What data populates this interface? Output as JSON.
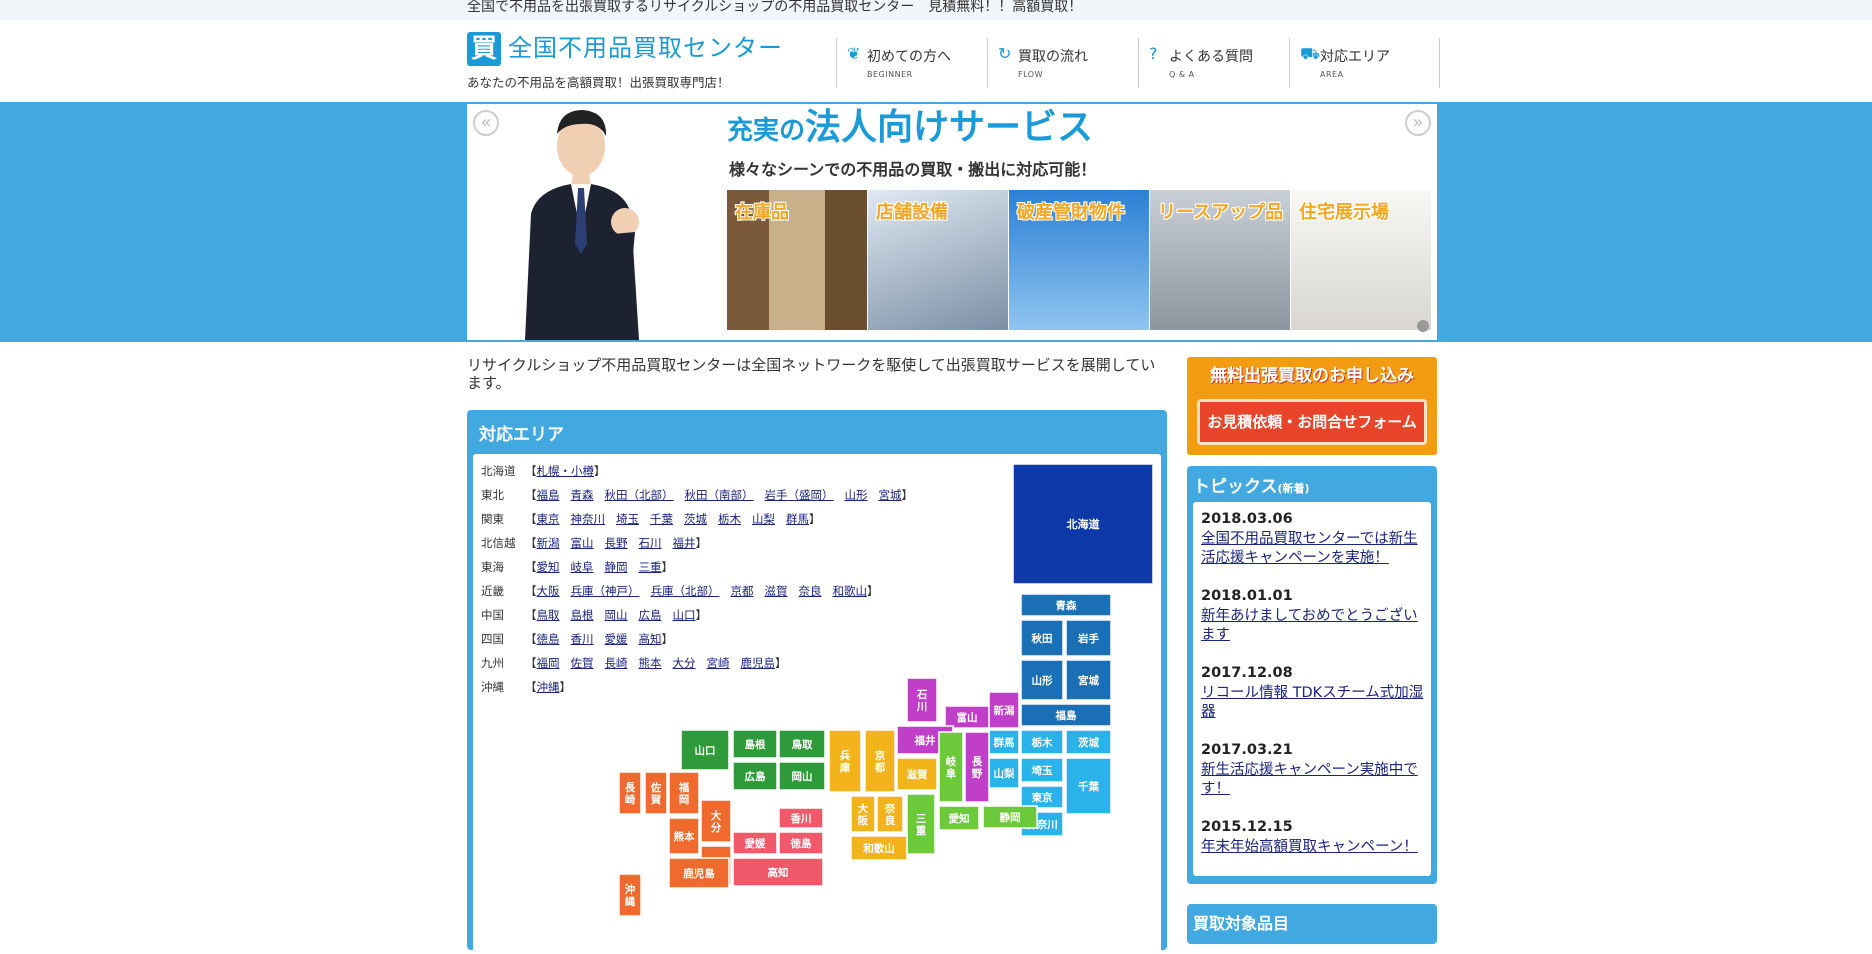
{
  "topbar": {
    "text": "全国で不用品を出張買取するリサイクルショップの不用品買取センター　見積無料！！高額買取！"
  },
  "header": {
    "logo_char": "買",
    "logo_title": "全国不用品買取センター",
    "logo_sub": "あなたの不用品を高額買取！出張買取専門店！",
    "nav": [
      {
        "label": "初めての方へ",
        "sub": "BEGINNER",
        "icon": "leaf-icon"
      },
      {
        "label": "買取の流れ",
        "sub": "FLOW",
        "icon": "refresh-icon"
      },
      {
        "label": "よくある質問",
        "sub": "Q & A",
        "icon": "question-icon"
      },
      {
        "label": "対応エリア",
        "sub": "AREA",
        "icon": "truck-icon"
      }
    ]
  },
  "hero": {
    "prev": "«",
    "next": "»",
    "title_small": "充実の",
    "title_main": "法人向けサービス",
    "lead": "様々なシーンでの不用品の買取・搬出に対応可能！",
    "tiles": [
      "在庫品",
      "店舗設備",
      "破産管財物件",
      "リースアップ品",
      "住宅展示場"
    ]
  },
  "intro": "リサイクルショップ不用品買取センターは全国ネットワークを駆使して出張買取サービスを展開しています。",
  "area": {
    "heading": "対応エリア",
    "rows": [
      {
        "region": "北海道",
        "cities": [
          "札幌・小樽"
        ]
      },
      {
        "region": "東北",
        "cities": [
          "福島",
          "青森",
          "秋田（北部）",
          "秋田（南部）",
          "岩手（盛岡）",
          "山形",
          "宮城"
        ]
      },
      {
        "region": "関東",
        "cities": [
          "東京",
          "神奈川",
          "埼玉",
          "千葉",
          "茨城",
          "栃木",
          "山梨",
          "群馬"
        ]
      },
      {
        "region": "北信越",
        "cities": [
          "新潟",
          "富山",
          "長野",
          "石川",
          "福井"
        ]
      },
      {
        "region": "東海",
        "cities": [
          "愛知",
          "岐阜",
          "静岡",
          "三重"
        ]
      },
      {
        "region": "近畿",
        "cities": [
          "大阪",
          "兵庫（神戸）",
          "兵庫（北部）",
          "京都",
          "滋賀",
          "奈良",
          "和歌山"
        ]
      },
      {
        "region": "中国",
        "cities": [
          "鳥取",
          "島根",
          "岡山",
          "広島",
          "山口"
        ]
      },
      {
        "region": "四国",
        "cities": [
          "徳島",
          "香川",
          "愛媛",
          "高知"
        ]
      },
      {
        "region": "九州",
        "cities": [
          "福岡",
          "佐賀",
          "長崎",
          "熊本",
          "大分",
          "宮崎",
          "鹿児島"
        ]
      },
      {
        "region": "沖縄",
        "cities": [
          "沖縄"
        ]
      }
    ],
    "map": [
      {
        "name": "北海道",
        "color": "#0d3aa8"
      },
      {
        "name": "青森",
        "color": "#1a6fb5"
      },
      {
        "name": "秋田",
        "color": "#1a6fb5"
      },
      {
        "name": "岩手",
        "color": "#1a6fb5"
      },
      {
        "name": "山形",
        "color": "#1a6fb5"
      },
      {
        "name": "宮城",
        "color": "#1a6fb5"
      },
      {
        "name": "福島",
        "color": "#1a6fb5"
      },
      {
        "name": "栃木",
        "color": "#2ab3e8"
      },
      {
        "name": "茨城",
        "color": "#2ab3e8"
      },
      {
        "name": "群馬",
        "color": "#2ab3e8"
      },
      {
        "name": "埼玉",
        "color": "#2ab3e8"
      },
      {
        "name": "山梨",
        "color": "#2ab3e8"
      },
      {
        "name": "東京",
        "color": "#2ab3e8"
      },
      {
        "name": "千葉",
        "color": "#2ab3e8"
      },
      {
        "name": "神奈川",
        "color": "#2ab3e8"
      },
      {
        "name": "新潟",
        "color": "#c13fc8"
      },
      {
        "name": "富山",
        "color": "#c13fc8"
      },
      {
        "name": "石川",
        "color": "#c13fc8"
      },
      {
        "name": "福井",
        "color": "#c13fc8"
      },
      {
        "name": "長野",
        "color": "#c13fc8"
      },
      {
        "name": "岐阜",
        "color": "#6cc93a"
      },
      {
        "name": "愛知",
        "color": "#6cc93a"
      },
      {
        "name": "静岡",
        "color": "#6cc93a"
      },
      {
        "name": "三重",
        "color": "#6cc93a"
      },
      {
        "name": "滋賀",
        "color": "#f3b31a"
      },
      {
        "name": "京都",
        "color": "#f3b31a"
      },
      {
        "name": "兵庫",
        "color": "#f3b31a"
      },
      {
        "name": "大阪",
        "color": "#f3b31a"
      },
      {
        "name": "奈良",
        "color": "#f3b31a"
      },
      {
        "name": "和歌山",
        "color": "#f3b31a"
      },
      {
        "name": "鳥取",
        "color": "#2f9a3a"
      },
      {
        "name": "島根",
        "color": "#2f9a3a"
      },
      {
        "name": "岡山",
        "color": "#2f9a3a"
      },
      {
        "name": "広島",
        "color": "#2f9a3a"
      },
      {
        "name": "山口",
        "color": "#2f9a3a"
      },
      {
        "name": "香川",
        "color": "#f0596a"
      },
      {
        "name": "徳島",
        "color": "#f0596a"
      },
      {
        "name": "愛媛",
        "color": "#f0596a"
      },
      {
        "name": "高知",
        "color": "#f0596a"
      },
      {
        "name": "福岡",
        "color": "#ef6a2c"
      },
      {
        "name": "佐賀",
        "color": "#ef6a2c"
      },
      {
        "name": "長崎",
        "color": "#ef6a2c"
      },
      {
        "name": "大分",
        "color": "#ef6a2c"
      },
      {
        "name": "熊本",
        "color": "#ef6a2c"
      },
      {
        "name": "宮崎",
        "color": "#ef6a2c"
      },
      {
        "name": "鹿児島",
        "color": "#ef6a2c"
      },
      {
        "name": "沖縄",
        "color": "#ef6a2c"
      }
    ]
  },
  "sidebar": {
    "cta_top": "無料出張買取のお申し込み",
    "cta_button": "お見積依頼・お問合せフォーム",
    "topics_heading": "トピックス",
    "topics_heading_small": "(新着)",
    "topics": [
      {
        "date": "2018.03.06",
        "title": "全国不用品買取センターでは新生活応援キャンペーンを実施！"
      },
      {
        "date": "2018.01.01",
        "title": "新年あけましておめでとうございます"
      },
      {
        "date": "2017.12.08",
        "title": "リコール情報 TDKスチーム式加湿器"
      },
      {
        "date": "2017.03.21",
        "title": "新生活応援キャンペーン実施中です！"
      },
      {
        "date": "2015.12.15",
        "title": "年末年始高額買取キャンペーン！"
      }
    ],
    "items_heading": "買取対象品目"
  }
}
